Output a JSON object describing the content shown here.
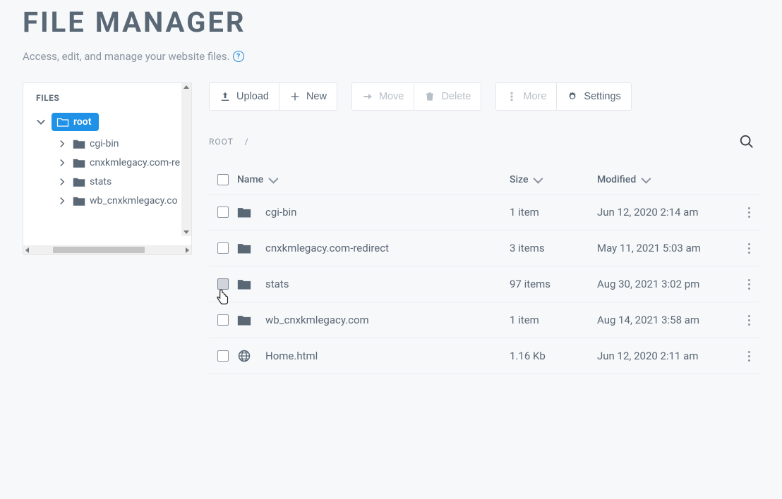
{
  "header": {
    "title": "FILE MANAGER",
    "subtitle": "Access, edit, and manage your website files."
  },
  "sidebar": {
    "title": "FILES",
    "root_label": "root",
    "items": [
      {
        "label": "cgi-bin"
      },
      {
        "label": "cnxkmlegacy.com-re"
      },
      {
        "label": "stats"
      },
      {
        "label": "wb_cnxkmlegacy.co"
      }
    ]
  },
  "toolbar": {
    "upload": "Upload",
    "new": "New",
    "move": "Move",
    "delete": "Delete",
    "more": "More",
    "settings": "Settings"
  },
  "breadcrumb": {
    "root": "ROOT",
    "sep": "/"
  },
  "table": {
    "headers": {
      "name": "Name",
      "size": "Size",
      "modified": "Modified"
    },
    "rows": [
      {
        "type": "folder",
        "name": "cgi-bin",
        "size": "1 item",
        "modified": "Jun 12, 2020 2:14 am"
      },
      {
        "type": "folder",
        "name": "cnxkmlegacy.com-redirect",
        "size": "3 items",
        "modified": "May 11, 2021 5:03 am"
      },
      {
        "type": "folder",
        "name": "stats",
        "size": "97 items",
        "modified": "Aug 30, 2021 3:02 pm"
      },
      {
        "type": "folder",
        "name": "wb_cnxkmlegacy.com",
        "size": "1 item",
        "modified": "Aug 14, 2021 3:58 am"
      },
      {
        "type": "html",
        "name": "Home.html",
        "size": "1.16 Kb",
        "modified": "Jun 12, 2020 2:11 am"
      }
    ]
  }
}
